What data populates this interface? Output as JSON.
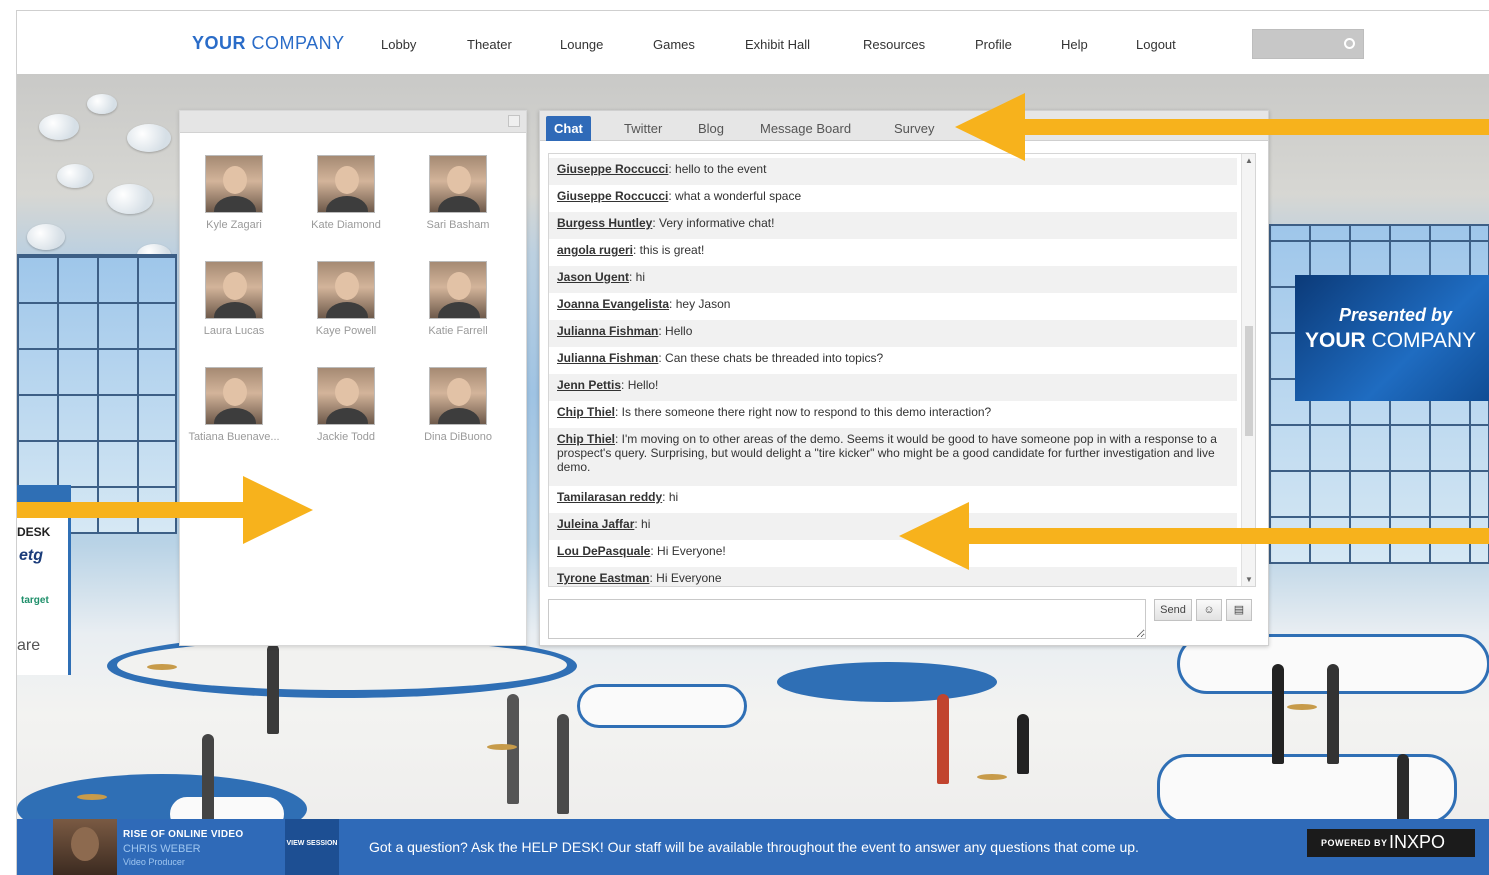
{
  "brand": {
    "bold": "YOUR",
    "light": " COMPANY"
  },
  "nav": [
    "Lobby",
    "Theater",
    "Lounge",
    "Games",
    "Exhibit Hall",
    "Resources",
    "Profile",
    "Help",
    "Logout"
  ],
  "sponsor": {
    "line1": "Presented by",
    "line2_bold": "YOUR",
    "line2_light": " COMPANY"
  },
  "booth": {
    "label": "DESK",
    "logo1": "etg",
    "logo2": "target",
    "logo3": "are"
  },
  "attendees": [
    {
      "name": "Kyle Zagari"
    },
    {
      "name": "Kate Diamond"
    },
    {
      "name": "Sari Basham"
    },
    {
      "name": "Laura Lucas"
    },
    {
      "name": "Kaye Powell"
    },
    {
      "name": "Katie Farrell"
    },
    {
      "name": "Tatiana Buenave..."
    },
    {
      "name": "Jackie Todd"
    },
    {
      "name": "Dina DiBuono"
    }
  ],
  "chat": {
    "tabs": [
      "Chat",
      "Twitter",
      "Blog",
      "Message Board",
      "Survey"
    ],
    "active_tab": "Chat",
    "messages": [
      {
        "who": "Giuseppe Roccucci",
        "text": ": hello to the event"
      },
      {
        "who": "Giuseppe Roccucci",
        "text": ": what a wonderful space"
      },
      {
        "who": "Burgess Huntley",
        "text": ": Very informative chat!"
      },
      {
        "who": "angola rugeri",
        "text": ": this is great!"
      },
      {
        "who": "Jason Ugent",
        "text": ": hi"
      },
      {
        "who": "Joanna Evangelista",
        "text": ": hey Jason"
      },
      {
        "who": "Julianna Fishman",
        "text": ": Hello"
      },
      {
        "who": "Julianna Fishman",
        "text": ": Can these chats be threaded into topics?"
      },
      {
        "who": "Jenn Pettis",
        "text": ": Hello!"
      },
      {
        "who": "Chip Thiel",
        "text": ": Is there someone there right now to respond to this demo interaction?"
      },
      {
        "who": "Chip Thiel",
        "text": ": I'm moving on to other areas of the demo. Seems it would be good to have someone pop in with a response to a prospect's query. Surprising, but would delight a \"tire kicker\" who might be a good candidate for further investigation and live demo."
      },
      {
        "who": "Tamilarasan reddy",
        "text": ": hi"
      },
      {
        "who": "Juleina Jaffar",
        "text": ": hi"
      },
      {
        "who": "Lou DePasquale",
        "text": ": Hi Everyone!"
      },
      {
        "who": "Tyrone Eastman",
        "text": ": Hi Everyone"
      }
    ],
    "send_label": "Send",
    "compose_placeholder": ""
  },
  "bottom": {
    "session_title": "RISE OF ONLINE VIDEO",
    "session_name": "CHRIS WEBER",
    "session_role": "Video Producer",
    "view_session": "VIEW SESSION",
    "help_text": "Got a question? Ask the HELP DESK! Our staff will be available throughout the event to answer any questions that come up.",
    "powered_small": "POWERED BY",
    "powered_brand": "INXPO"
  },
  "colors": {
    "accent": "#2f6ab8",
    "arrow": "#f7b21c"
  }
}
